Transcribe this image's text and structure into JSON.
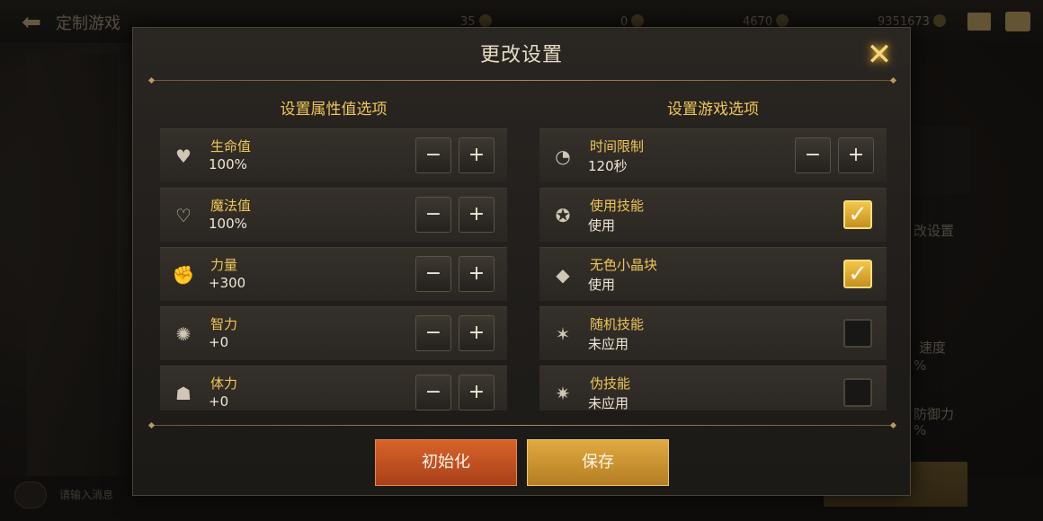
{
  "background": {
    "title": "定制游戏",
    "resources": [
      "35",
      "0",
      "4670",
      "9351673"
    ],
    "right_labels": [
      "改设置",
      "速度",
      "%",
      "防御力",
      "%"
    ],
    "chat_placeholder": "请输入消息"
  },
  "modal": {
    "title": "更改设置",
    "close_label": "✕",
    "left_title": "设置属性值选项",
    "right_title": "设置游戏选项",
    "minus": "−",
    "plus": "+",
    "check": "✓",
    "attributes": [
      {
        "name": "生命值",
        "value": "100%",
        "icon": "heart-icon"
      },
      {
        "name": "魔法值",
        "value": "100%",
        "icon": "mana-heart-icon"
      },
      {
        "name": "力量",
        "value": "+300",
        "icon": "strength-arm-icon"
      },
      {
        "name": "智力",
        "value": "+0",
        "icon": "intellect-icon"
      },
      {
        "name": "体力",
        "value": "+0",
        "icon": "stamina-body-icon"
      }
    ],
    "options": [
      {
        "name": "时间限制",
        "value": "120秒",
        "icon": "timer-icon",
        "control": "stepper"
      },
      {
        "name": "使用技能",
        "value": "使用",
        "icon": "skill-icon",
        "control": "checkbox",
        "checked": true
      },
      {
        "name": "无色小晶块",
        "value": "使用",
        "icon": "crystal-cube-icon",
        "control": "checkbox",
        "checked": true
      },
      {
        "name": "随机技能",
        "value": "未应用",
        "icon": "random-skill-icon",
        "control": "checkbox",
        "checked": false
      },
      {
        "name": "伪技能",
        "value": "未应用",
        "icon": "fake-skill-icon",
        "control": "checkbox",
        "checked": false
      }
    ],
    "reset_label": "初始化",
    "save_label": "保存"
  },
  "colors": {
    "accent_gold": "#f0c65a",
    "reset_orange": "#c9531f",
    "save_gold": "#d29a35"
  }
}
